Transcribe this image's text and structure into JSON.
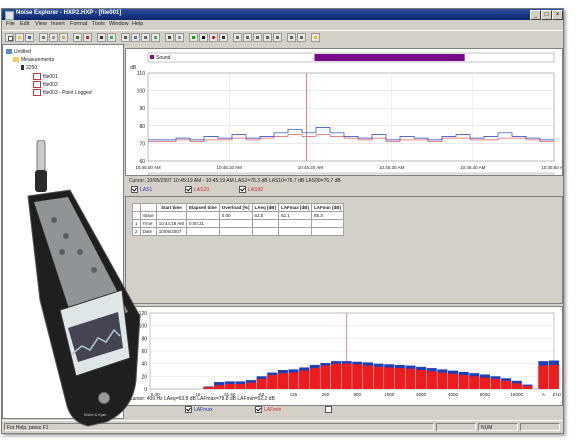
{
  "window": {
    "title": "Noise Explorer - HXP2.HXP - [file001]"
  },
  "menu": [
    "File",
    "Edit",
    "View",
    "Insert",
    "Format",
    "Tools",
    "Window",
    "Help"
  ],
  "tree": {
    "root": "Untitled",
    "measurements": "Measurements",
    "device": "2250",
    "items": [
      "file001",
      "file002",
      "file003 - Point Logged"
    ]
  },
  "time_chart": {
    "legend_label": "Sound",
    "y_unit": "dB",
    "y_ticks": [
      "110",
      "100",
      "90",
      "80",
      "70",
      "60"
    ],
    "x_ticks": [
      "10:45:00 AM",
      "10:45:10 AM",
      "10:45:20 AM",
      "10:45:30 AM",
      "10:45:40 AM",
      "10:45:50 AM"
    ]
  },
  "cursor_info": "Cursor: 10/05/2007 10:45:19 AM - 10:45:19 AM  LAS1=76.3 dB  LAS10=76.7 dB  LAS90=76.7 dB",
  "series_checks": [
    "LAS1",
    "LAS10",
    "LAS90"
  ],
  "table": {
    "headers": [
      "",
      "",
      "Start time",
      "Elapsed time",
      "Overload [%]",
      "LAeq [dB]",
      "LAFmax [dB]",
      "LAFmin [dB]"
    ],
    "rows": [
      [
        "",
        "Value",
        "",
        "",
        "0.00",
        "63.5",
        "62.1",
        "85.3"
      ],
      [
        "1",
        "Time",
        "10:44:18 AM",
        "0:00:31",
        "",
        "",
        "",
        ""
      ],
      [
        "2",
        "Date",
        "10/05/2007",
        "",
        "",
        "",
        "",
        ""
      ]
    ]
  },
  "spectrum": {
    "y_unit": "dB",
    "y_ticks": [
      "120",
      "100",
      "80",
      "60",
      "40",
      "20",
      "0"
    ],
    "x_ticks": [
      "6.30",
      "16",
      "31.50",
      "63",
      "125",
      "250",
      "500",
      "1000",
      "2000",
      "4000",
      "8000",
      "16000",
      "A",
      "Z"
    ],
    "x_unit": "Hz",
    "cursor_info": "Cursor: 400 Hz  LAeq=63.8 dB  LAFmax=78.8 dB  LAFmin=52.2 dB",
    "checks": [
      "LAFmax",
      "LAFmin",
      ""
    ]
  },
  "status": {
    "help": "For Help, press F1",
    "mode": "NUM"
  },
  "chart_data": {
    "type": "bar",
    "title": "",
    "xlabel": "Hz",
    "ylabel": "dB",
    "ylim": [
      0,
      120
    ],
    "categories": [
      "6.3",
      "8",
      "10",
      "12.5",
      "16",
      "20",
      "25",
      "31.5",
      "40",
      "50",
      "63",
      "80",
      "100",
      "125",
      "160",
      "200",
      "250",
      "315",
      "400",
      "500",
      "630",
      "800",
      "1000",
      "1250",
      "1600",
      "2000",
      "2500",
      "3150",
      "4000",
      "5000",
      "6300",
      "8000",
      "10000",
      "12500",
      "16000",
      "20000",
      "A",
      "Z"
    ],
    "series": [
      {
        "name": "LAFmax",
        "values": [
          0,
          0,
          0,
          0,
          0,
          4,
          11,
          12,
          12,
          14,
          20,
          26,
          30,
          31,
          34,
          38,
          41,
          44,
          44,
          43,
          42,
          40,
          39,
          38,
          37,
          35,
          33,
          31,
          29,
          27,
          25,
          23,
          20,
          17,
          13,
          7,
          44,
          45
        ]
      },
      {
        "name": "LAFmin",
        "values": [
          0,
          0,
          0,
          0,
          0,
          3,
          6,
          8,
          8,
          10,
          16,
          22,
          25,
          26,
          29,
          33,
          37,
          40,
          40,
          39,
          37,
          35,
          34,
          33,
          32,
          30,
          28,
          26,
          24,
          22,
          20,
          18,
          16,
          13,
          9,
          5,
          37,
          38
        ]
      }
    ],
    "colors": {
      "LAFmax": "#1d3fb8",
      "LAFmin": "#ee1c1c",
      "extra": "#1e7a2e"
    },
    "time_series": {
      "x": [
        "10:45:00 AM",
        "10:45:10 AM",
        "10:45:20 AM",
        "10:45:30 AM",
        "10:45:40 AM",
        "10:45:50 AM"
      ],
      "ylim": [
        60,
        110
      ],
      "LAS1": [
        72,
        72,
        73,
        72,
        74,
        73,
        75,
        73,
        74,
        76,
        78,
        76,
        79,
        76,
        74,
        73,
        75,
        72,
        74,
        73,
        72,
        74,
        75,
        73,
        74,
        76,
        74,
        73,
        72
      ],
      "LAS10": [
        71,
        71,
        72,
        71,
        72,
        72,
        73,
        72,
        73,
        74,
        75,
        74,
        75,
        74,
        73,
        72,
        73,
        71,
        72,
        72,
        71,
        73,
        73,
        72,
        72,
        73,
        73,
        72,
        71
      ],
      "marker_range": [
        "10:45:20 AM",
        "10:45:39 AM"
      ]
    }
  },
  "colors": {
    "bar_purple": "#7a0a8a",
    "title_blue": "#0a246a",
    "plot_bg": "#ffffff"
  },
  "device": {
    "brand": "Brüel & Kjær",
    "model": "2250"
  }
}
